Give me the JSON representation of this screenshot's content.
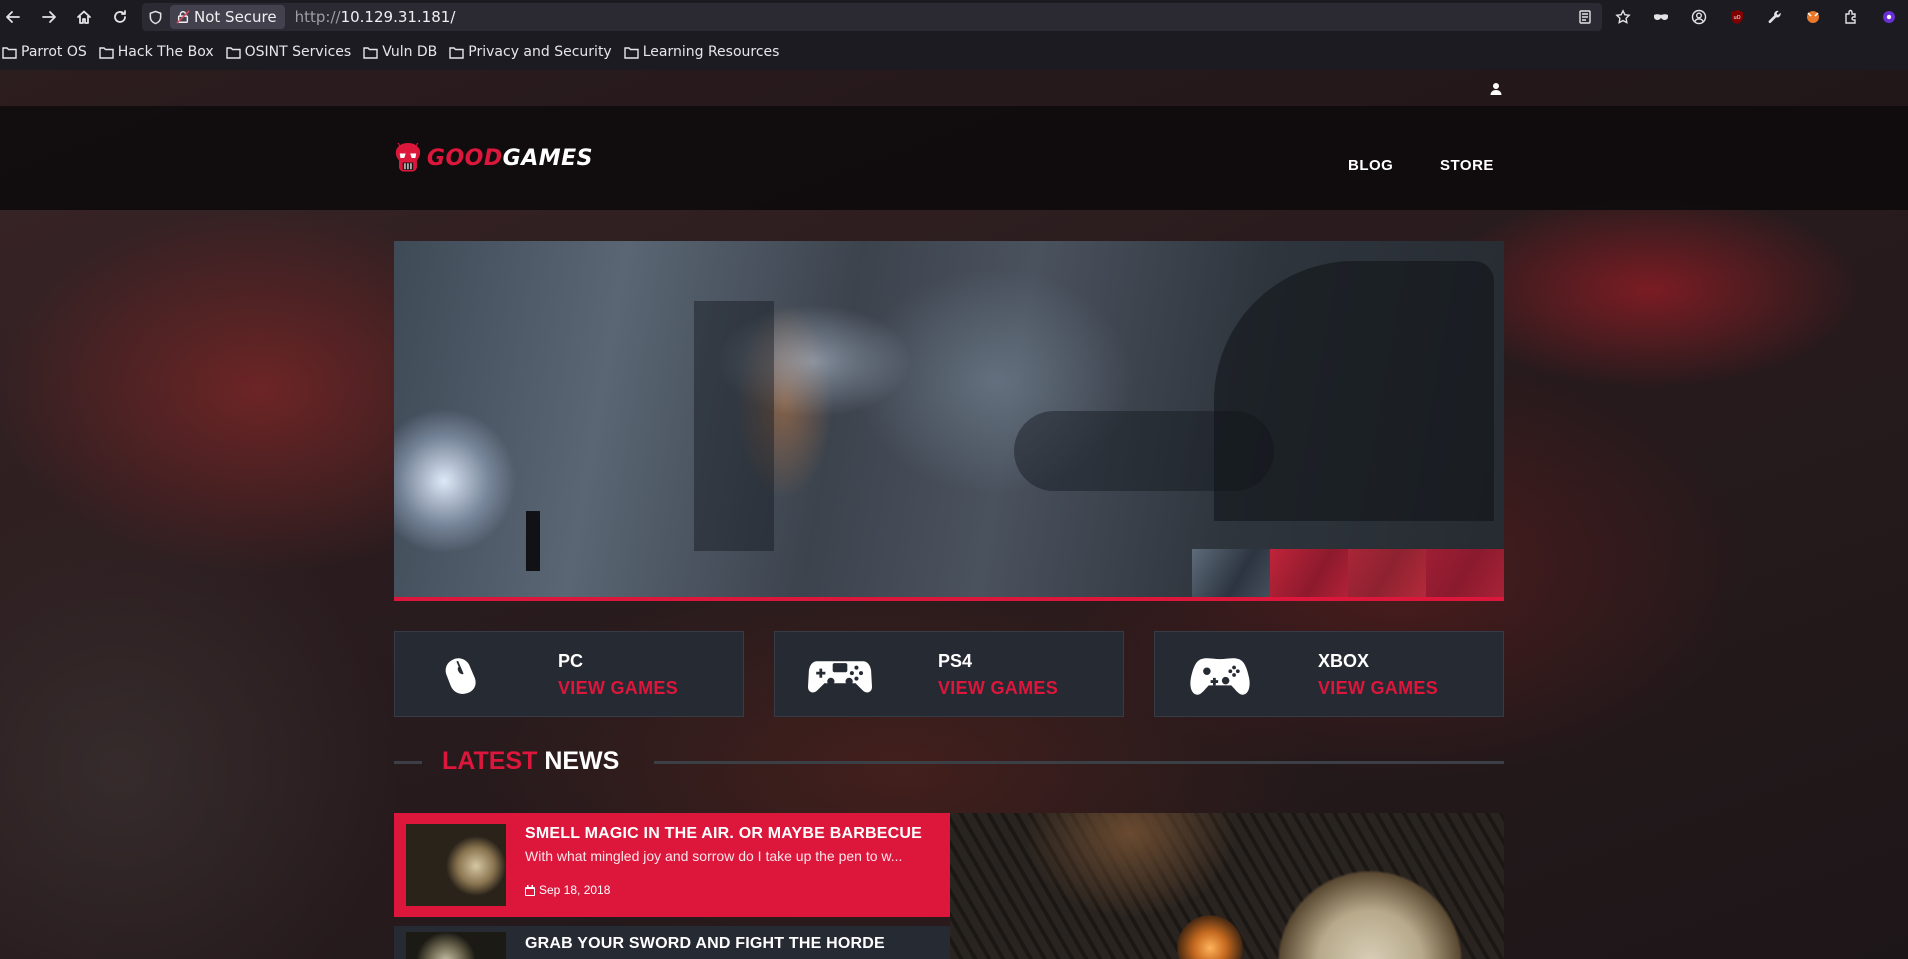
{
  "browser": {
    "security_label": "Not Secure",
    "url_protocol": "http://",
    "url_host": "10.129.31.181/"
  },
  "bookmarks": [
    {
      "label": "Parrot OS"
    },
    {
      "label": "Hack The Box"
    },
    {
      "label": "OSINT Services"
    },
    {
      "label": "Vuln DB"
    },
    {
      "label": "Privacy and Security"
    },
    {
      "label": "Learning Resources"
    }
  ],
  "site": {
    "logo_part1": "GOOD",
    "logo_part2": "GAMES",
    "nav": [
      {
        "label": "BLOG"
      },
      {
        "label": "STORE"
      }
    ]
  },
  "categories": [
    {
      "name": "PC",
      "link": "VIEW GAMES",
      "icon": "mouse-icon"
    },
    {
      "name": "PS4",
      "link": "VIEW GAMES",
      "icon": "ps4-controller-icon"
    },
    {
      "name": "XBOX",
      "link": "VIEW GAMES",
      "icon": "xbox-controller-icon"
    }
  ],
  "news": {
    "heading_red": "LATEST",
    "heading_white": "NEWS",
    "items": [
      {
        "title": "SMELL MAGIC IN THE AIR. OR MAYBE BARBECUE",
        "excerpt": "With what mingled joy and sorrow do I take up the pen to w...",
        "date": "Sep 18, 2018"
      },
      {
        "title": "GRAB YOUR SWORD AND FIGHT THE HORDE"
      }
    ]
  },
  "colors": {
    "accent": "#dd163b",
    "card_bg": "#262a33",
    "navbar_bg": "#0c0a0b"
  }
}
